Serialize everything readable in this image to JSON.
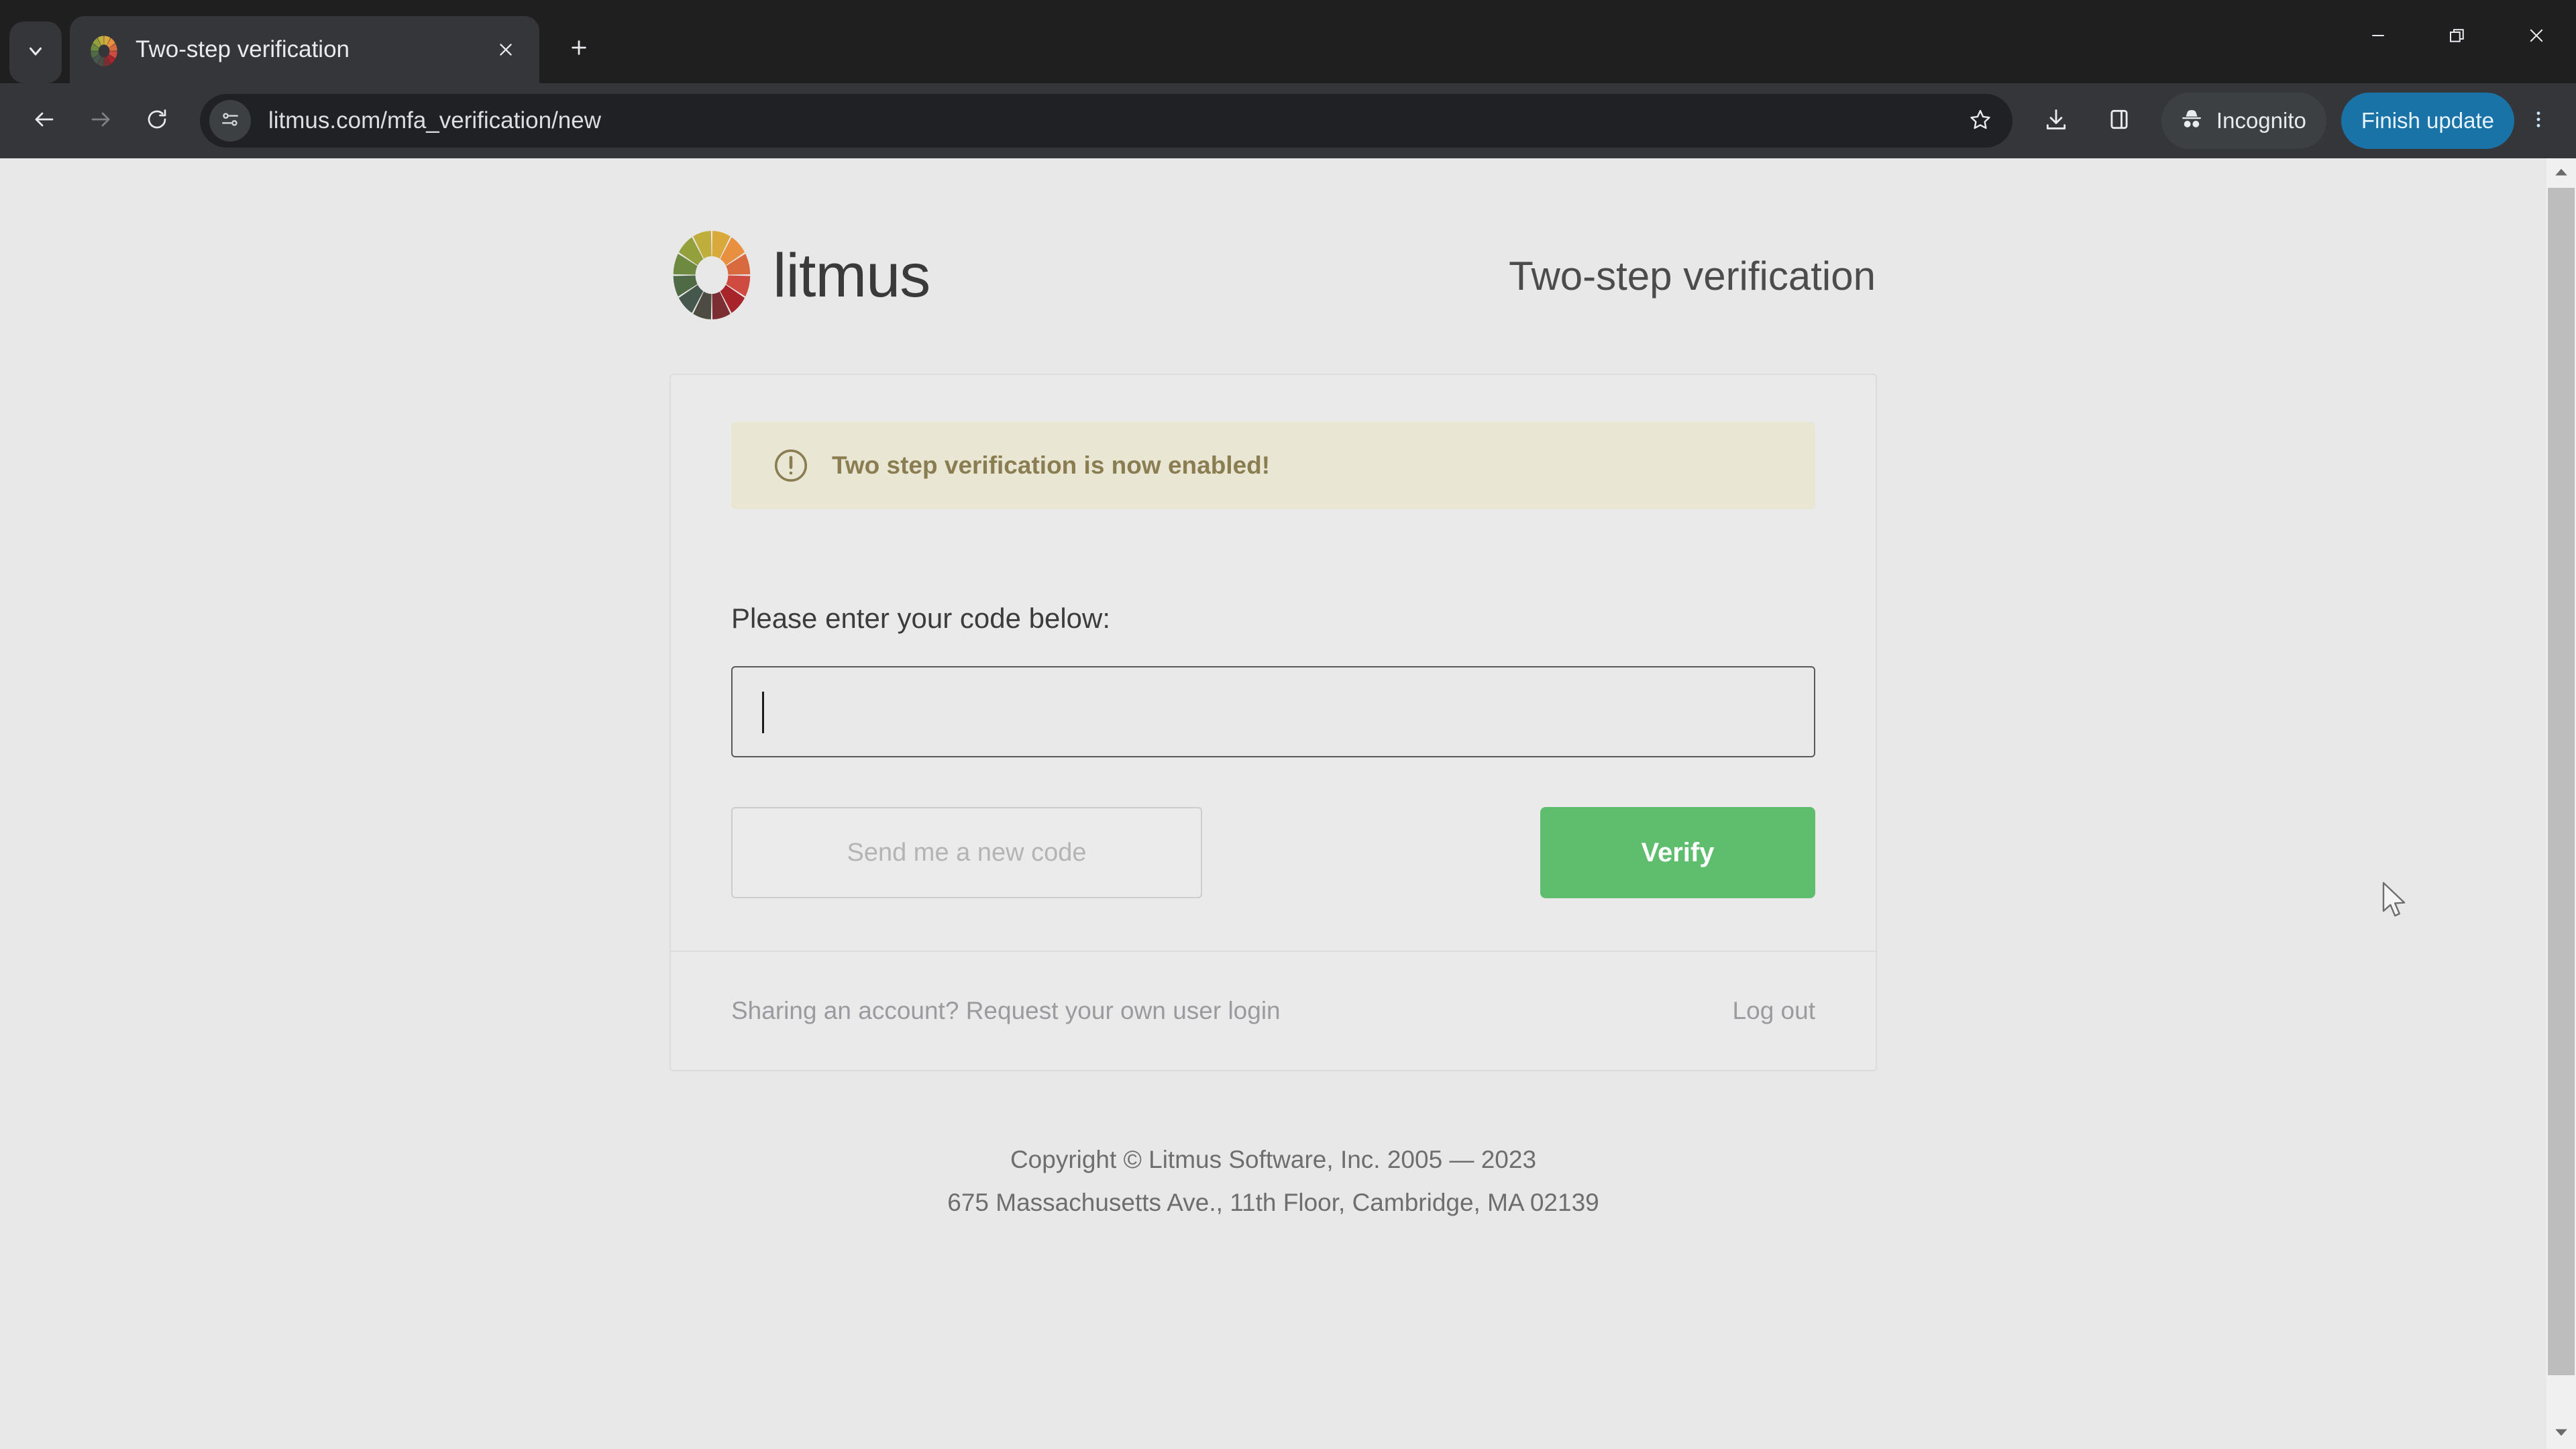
{
  "browser": {
    "tab_search_icon": "chevron-down-icon",
    "tab": {
      "title": "Two-step verification",
      "favicon": "litmus-color-wheel-icon",
      "close_icon": "close-icon"
    },
    "new_tab_icon": "plus-icon",
    "window_controls": {
      "minimize_icon": "minimize-icon",
      "restore_icon": "restore-icon",
      "close_icon": "close-icon"
    },
    "toolbar": {
      "back_icon": "arrow-left-icon",
      "forward_icon": "arrow-right-icon",
      "reload_icon": "reload-icon",
      "site_info_icon": "tune-settings-icon",
      "url": "litmus.com/mfa_verification/new",
      "url_placeholder": "Search Google or type a URL",
      "bookmark_icon": "star-icon",
      "downloads_icon": "download-icon",
      "side_panel_icon": "side-panel-icon",
      "incognito_icon": "incognito-hat-icon",
      "incognito_label": "Incognito",
      "update_label": "Finish update",
      "update_color": "#1a73a7",
      "menu_icon": "three-dot-menu-icon"
    }
  },
  "page": {
    "brand": {
      "wordmark": "litmus",
      "logo_icon": "litmus-color-wheel-icon",
      "wheel_colors": [
        "#d9a93c",
        "#e8903f",
        "#d9693f",
        "#cf4a41",
        "#a8242b",
        "#7b2f33",
        "#4e4b42",
        "#46574d",
        "#4f6b46",
        "#6e8a40",
        "#93a03b",
        "#bfae3c"
      ]
    },
    "title": "Two-step verification",
    "alert": {
      "icon": "exclamation-circle-icon",
      "message": "Two step verification is now enabled!",
      "bg_color": "#e9e6d4",
      "text_color": "#8a7d52"
    },
    "form": {
      "code_label": "Please enter your code below:",
      "code_value": "",
      "code_placeholder": "",
      "resend_label": "Send me a new code",
      "resend_disabled": "true",
      "verify_label": "Verify",
      "verify_color": "#5fbd6e"
    },
    "card_footer": {
      "share_link": "Sharing an account? Request your own user login",
      "logout_link": "Log out"
    },
    "copyright": {
      "line1": "Copyright © Litmus Software, Inc. 2005 — 2023",
      "line2": "675 Massachusetts Ave., 11th Floor, Cambridge, MA 02139"
    }
  },
  "scrollbar": {
    "up_icon": "triangle-up-icon",
    "down_icon": "triangle-down-icon"
  }
}
